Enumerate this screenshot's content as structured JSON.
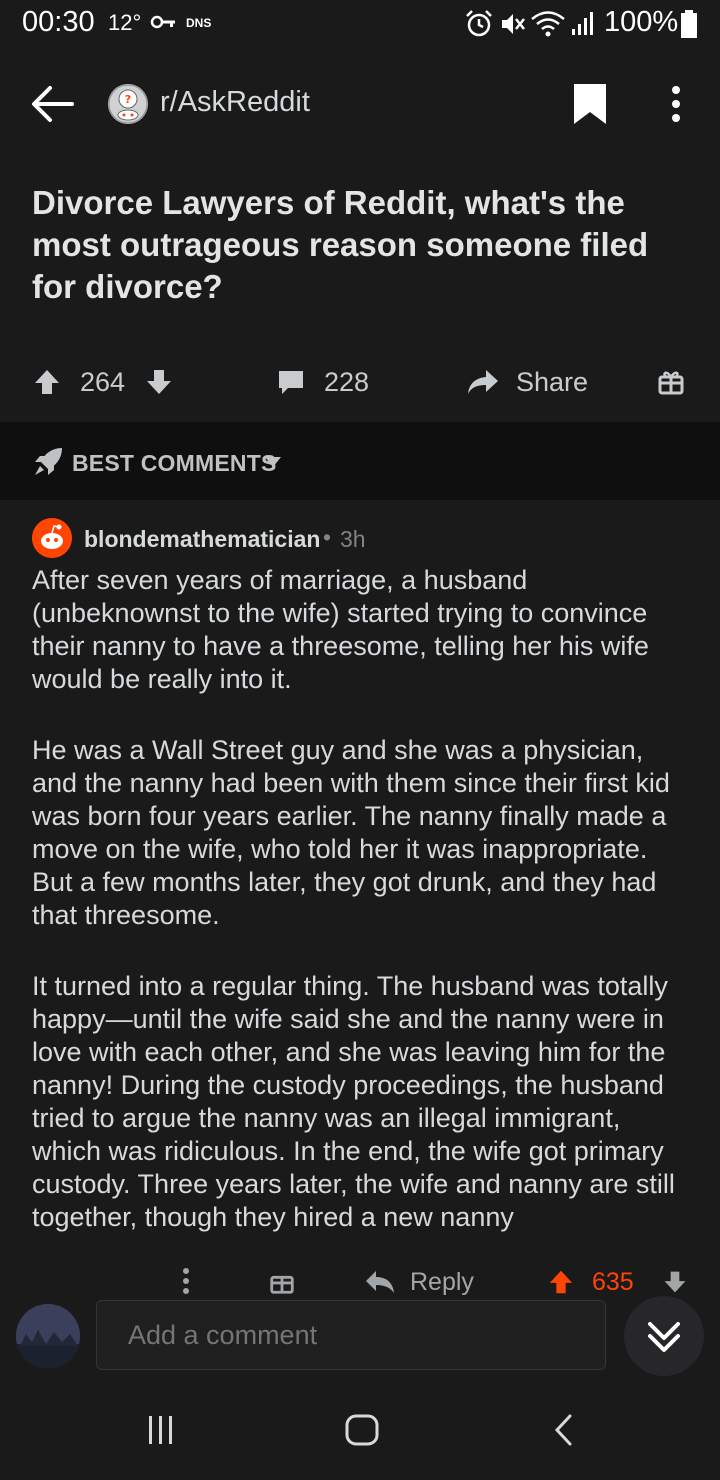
{
  "status_bar": {
    "time": "00:30",
    "temperature": "12°",
    "dns": "DNS",
    "battery": "100%"
  },
  "header": {
    "subreddit": "r/AskReddit",
    "icons": [
      "back-arrow-icon",
      "subreddit-icon",
      "bookmark-icon",
      "more-vert-icon"
    ]
  },
  "post": {
    "title": "Divorce Lawyers of Reddit, what's the most outrageous reason someone filed for divorce?",
    "score": "264",
    "comments": "228",
    "share_label": "Share"
  },
  "sort": {
    "label": "BEST COMMENTS"
  },
  "comment": {
    "author": "blondemathematician",
    "separator": "•",
    "age": "3h",
    "paragraphs": [
      "After seven years of marriage, a husband (unbeknownst to the wife) started trying to convince their nanny to have a threesome, telling her his wife would be really into it.",
      "He was a Wall Street guy and she was a physician, and the nanny had been with them since their first kid was born four years earlier. The nanny finally made a move on the wife, who told her it was inappropriate. But a few months later, they got drunk, and they had that threesome.",
      "It turned into a regular thing. The husband was totally happy—until the wife said she and the nanny were in love with each other, and she was leaving him for the nanny! During the custody proceedings, the husband tried to argue the nanny was an illegal immigrant, which was ridiculous. In the end, the wife got primary custody. Three years later, the wife and nanny are still together, though they hired a new nanny"
    ],
    "reply_label": "Reply",
    "score": "635"
  },
  "composer": {
    "placeholder": "Add a comment"
  },
  "colors": {
    "background": "#1a1a1b",
    "accent_orange": "#ff4500",
    "text": "#d7dadc",
    "muted": "#818384"
  }
}
